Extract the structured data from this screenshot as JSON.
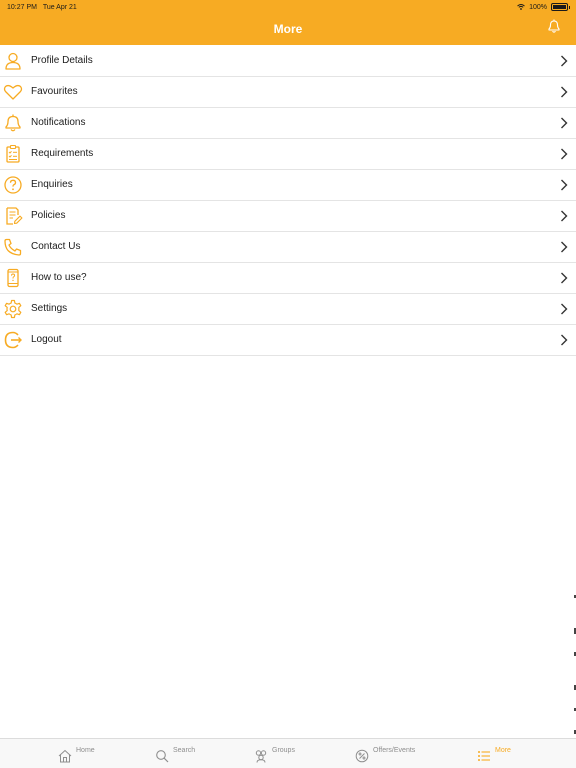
{
  "status_bar": {
    "time": "10:27 PM",
    "date": "Tue Apr 21",
    "battery": "100%"
  },
  "header": {
    "title": "More",
    "background_color": "#f7ab23"
  },
  "menu": {
    "items": [
      {
        "label": "Profile Details",
        "icon": "user-icon"
      },
      {
        "label": "Favourites",
        "icon": "heart-icon"
      },
      {
        "label": "Notifications",
        "icon": "bell-icon"
      },
      {
        "label": "Requirements",
        "icon": "clipboard-checklist-icon"
      },
      {
        "label": "Enquiries",
        "icon": "question-circle-icon"
      },
      {
        "label": "Policies",
        "icon": "document-edit-icon"
      },
      {
        "label": "Contact Us",
        "icon": "phone-icon"
      },
      {
        "label": "How to use?",
        "icon": "mobile-help-icon"
      },
      {
        "label": "Settings",
        "icon": "gear-icon"
      },
      {
        "label": "Logout",
        "icon": "logout-icon"
      }
    ]
  },
  "tabbar": {
    "tabs": [
      {
        "label": "Home",
        "icon": "home-icon",
        "active": false
      },
      {
        "label": "Search",
        "icon": "search-icon",
        "active": false
      },
      {
        "label": "Groups",
        "icon": "groups-icon",
        "active": false
      },
      {
        "label": "Offers/Events",
        "icon": "offer-badge-icon",
        "active": false
      },
      {
        "label": "More",
        "icon": "list-icon",
        "active": true
      }
    ],
    "active_color": "#f7ab23",
    "inactive_color": "#8e8e8e"
  }
}
